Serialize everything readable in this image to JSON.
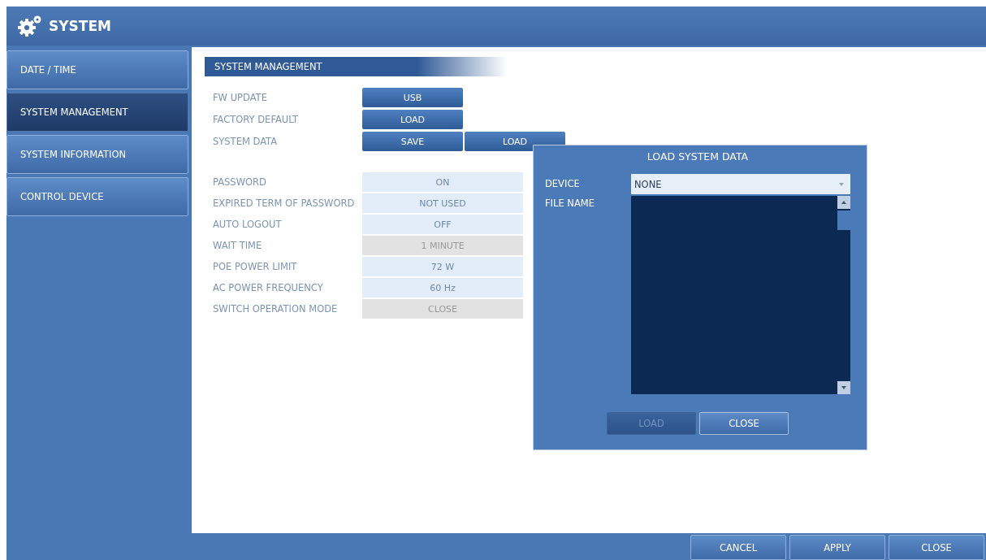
{
  "window": {
    "title": "SYSTEM"
  },
  "sidebar": {
    "items": [
      {
        "label": "DATE / TIME",
        "selected": false
      },
      {
        "label": "SYSTEM MANAGEMENT",
        "selected": true
      },
      {
        "label": "SYSTEM INFORMATION",
        "selected": false
      },
      {
        "label": "CONTROL DEVICE",
        "selected": false
      }
    ]
  },
  "section": {
    "title": "SYSTEM MANAGEMENT"
  },
  "actions": [
    {
      "label": "FW UPDATE",
      "buttons": [
        "USB"
      ]
    },
    {
      "label": "FACTORY DEFAULT",
      "buttons": [
        "LOAD"
      ]
    },
    {
      "label": "SYSTEM DATA",
      "buttons": [
        "SAVE",
        "LOAD"
      ]
    }
  ],
  "settings": [
    {
      "label": "PASSWORD",
      "value": "ON",
      "disabled": false
    },
    {
      "label": "EXPIRED TERM OF PASSWORD",
      "value": "NOT USED",
      "disabled": false
    },
    {
      "label": "AUTO LOGOUT",
      "value": "OFF",
      "disabled": false
    },
    {
      "label": "WAIT TIME",
      "value": "1 MINUTE",
      "disabled": true
    },
    {
      "label": "POE POWER LIMIT",
      "value": "72 W",
      "disabled": false
    },
    {
      "label": "AC POWER FREQUENCY",
      "value": "60 Hz",
      "disabled": false
    },
    {
      "label": "SWITCH OPERATION MODE",
      "value": "CLOSE",
      "disabled": true
    }
  ],
  "dialog": {
    "title": "LOAD SYSTEM DATA",
    "device_label": "DEVICE",
    "device_value": "NONE",
    "file_name_label": "FILE NAME",
    "buttons": [
      {
        "label": "LOAD",
        "disabled": true
      },
      {
        "label": "CLOSE",
        "disabled": false
      }
    ]
  },
  "footer_buttons": [
    "CANCEL",
    "APPLY",
    "CLOSE"
  ]
}
